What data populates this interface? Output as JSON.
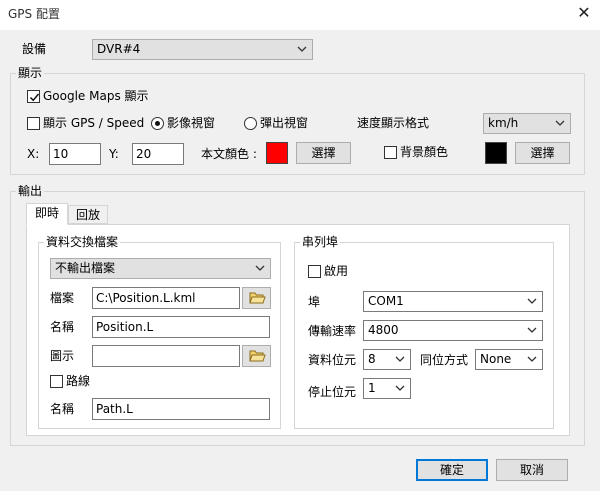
{
  "window": {
    "title": "GPS 配置",
    "close_glyph": "✕"
  },
  "device": {
    "label": "設備",
    "value": "DVR#4"
  },
  "display": {
    "group_title": "顯示",
    "google_maps": {
      "label": "Google Maps 顯示",
      "checked": true
    },
    "show_gps_speed": {
      "label": "顯示 GPS / Speed",
      "checked": false
    },
    "radio_video": {
      "label": "影像視窗",
      "selected": true
    },
    "radio_popup": {
      "label": "彈出視窗",
      "selected": false
    },
    "speed_format_label": "速度顯示格式",
    "speed_format_value": "km/h",
    "x_label": "X:",
    "x_value": "10",
    "y_label": "Y:",
    "y_value": "20",
    "text_color_label": "本文顏色 :",
    "text_color": "#ff0000",
    "select_button": "選擇",
    "bg_color": {
      "label": "背景顏色",
      "checked": false
    },
    "bg_color_value": "#000000",
    "select_button_2": "選擇"
  },
  "output": {
    "group_title": "輸出",
    "tabs": [
      "即時",
      "回放"
    ],
    "active_tab": 0,
    "exchange": {
      "group_title": "資料交換檔案",
      "mode_value": "不輸出檔案",
      "file_label": "檔案",
      "file_value": "C:\\Position.L.kml",
      "name_label": "名稱",
      "name_value": "Position.L",
      "icon_label": "圖示",
      "icon_value": "",
      "route": {
        "label": "路線",
        "checked": false
      },
      "route_name_label": "名稱",
      "route_name_value": "Path.L"
    },
    "serial": {
      "group_title": "串列埠",
      "enable": {
        "label": "啟用",
        "checked": false
      },
      "port_label": "埠",
      "port_value": "COM1",
      "baud_label": "傳輸速率",
      "baud_value": "4800",
      "data_bits_label": "資料位元",
      "data_bits_value": "8",
      "parity_label": "同位方式",
      "parity_value": "None",
      "stop_bits_label": "停止位元",
      "stop_bits_value": "1"
    }
  },
  "footer": {
    "ok": "確定",
    "cancel": "取消"
  },
  "colors": {
    "accent": "#0078d7",
    "panel_bg": "#f0f0f0",
    "border": "#d5d5d5"
  },
  "icons": [
    "close-icon",
    "chevron-down-icon",
    "checkmark-icon",
    "folder-icon"
  ]
}
